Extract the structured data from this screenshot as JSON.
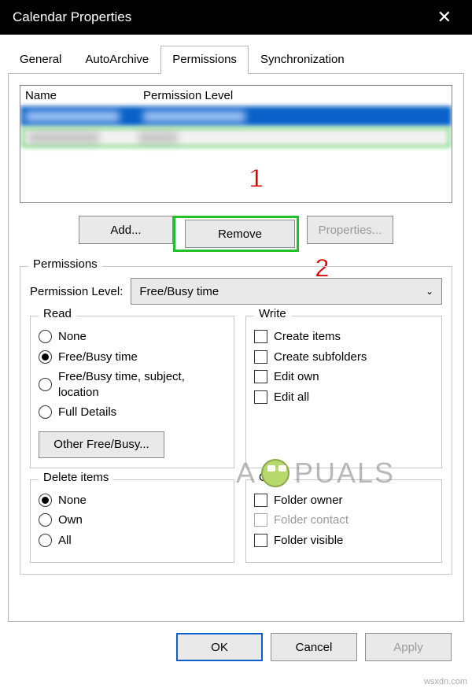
{
  "title": "Calendar Properties",
  "tabs": [
    "General",
    "AutoArchive",
    "Permissions",
    "Synchronization"
  ],
  "activeTab": "Permissions",
  "list": {
    "headers": [
      "Name",
      "Permission Level"
    ]
  },
  "buttons": {
    "add": "Add...",
    "remove": "Remove",
    "properties": "Properties..."
  },
  "annotations": {
    "one": "1",
    "two": "2"
  },
  "permGroup": {
    "title": "Permissions",
    "levelLabel": "Permission Level:",
    "levelValue": "Free/Busy time",
    "read": {
      "title": "Read",
      "opts": [
        "None",
        "Free/Busy time",
        "Free/Busy time, subject, location",
        "Full Details"
      ],
      "selected": "Free/Busy time",
      "otherBtn": "Other Free/Busy..."
    },
    "write": {
      "title": "Write",
      "opts": [
        "Create items",
        "Create subfolders",
        "Edit own",
        "Edit all"
      ]
    },
    "delete": {
      "title": "Delete items",
      "opts": [
        "None",
        "Own",
        "All"
      ],
      "selected": "None"
    },
    "other": {
      "title": "Other",
      "opts": [
        "Folder owner",
        "Folder contact",
        "Folder visible"
      ],
      "disabled": [
        "Folder contact"
      ]
    }
  },
  "bottom": {
    "ok": "OK",
    "cancel": "Cancel",
    "apply": "Apply"
  },
  "watermark": {
    "pre": "A",
    "post": "PUALS"
  },
  "source": "wsxdn.com"
}
